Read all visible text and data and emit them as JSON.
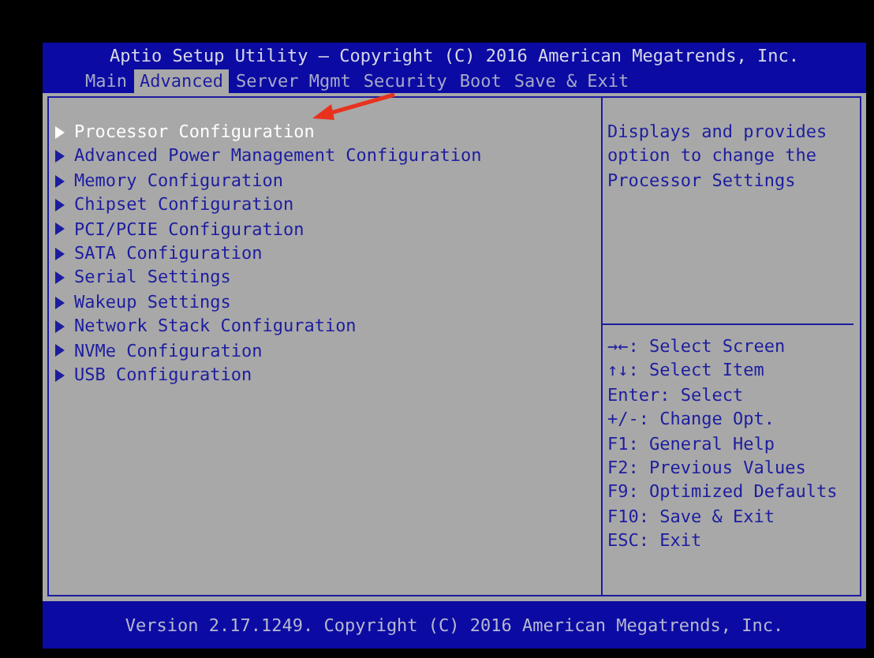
{
  "title": "Aptio Setup Utility – Copyright (C) 2016 American Megatrends, Inc.",
  "tabs": [
    {
      "label": "Main",
      "selected": false
    },
    {
      "label": "Advanced",
      "selected": true
    },
    {
      "label": "Server Mgmt",
      "selected": false
    },
    {
      "label": "Security",
      "selected": false
    },
    {
      "label": "Boot",
      "selected": false
    },
    {
      "label": "Save & Exit",
      "selected": false
    }
  ],
  "menu_items": [
    {
      "label": "Processor Configuration",
      "selected": true
    },
    {
      "label": "Advanced Power Management Configuration",
      "selected": false
    },
    {
      "label": "Memory Configuration",
      "selected": false
    },
    {
      "label": "Chipset Configuration",
      "selected": false
    },
    {
      "label": "PCI/PCIE Configuration",
      "selected": false
    },
    {
      "label": "SATA Configuration",
      "selected": false
    },
    {
      "label": "Serial Settings",
      "selected": false
    },
    {
      "label": "Wakeup Settings",
      "selected": false
    },
    {
      "label": "Network Stack Configuration",
      "selected": false
    },
    {
      "label": "NVMe Configuration",
      "selected": false
    },
    {
      "label": "USB Configuration",
      "selected": false
    }
  ],
  "help_text": [
    "Displays and provides",
    "option to change the",
    "Processor Settings"
  ],
  "key_help": [
    "→←: Select Screen",
    "↑↓: Select Item",
    "Enter: Select",
    "+/-: Change Opt.",
    "F1: General Help",
    "F2: Previous Values",
    "F9: Optimized Defaults",
    "F10: Save & Exit",
    "ESC: Exit"
  ],
  "footer": "Version 2.17.1249. Copyright (C) 2016 American Megatrends, Inc."
}
